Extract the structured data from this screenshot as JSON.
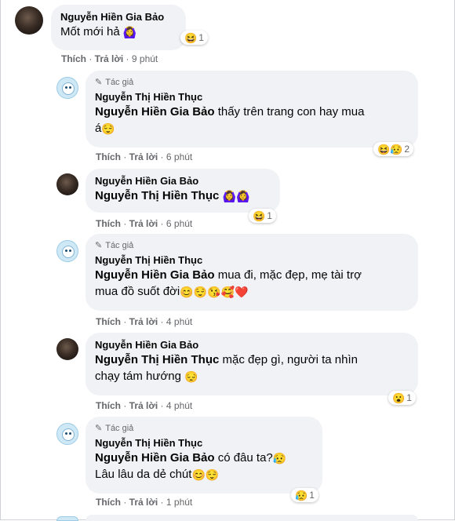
{
  "comments": [
    {
      "author": "Nguyễn Hiền Gia Bảo",
      "text": "Mốt mới hả",
      "emoji": "🙆‍♀️",
      "reaction": {
        "icon": "😆",
        "count": "1"
      },
      "actions": {
        "like": "Thích",
        "reply": "Trả lời",
        "time": "9 phút"
      }
    },
    {
      "author_tag": "Tác giả",
      "author": "Nguyễn Thị Hiền Thục",
      "mention": "Nguyễn Hiền Gia Bảo",
      "text_line1": " thấy trên trang con hay mua",
      "text_line2": "á",
      "emoji": "😌",
      "reaction": {
        "icon": "😆😥",
        "count": "2"
      },
      "actions": {
        "like": "Thích",
        "reply": "Trả lời",
        "time": "6 phút"
      }
    },
    {
      "author": "Nguyễn Hiền Gia Bảo",
      "mention": "Nguyễn Thị Hiền Thục",
      "emoji": "🙆‍♀️🙆‍♀️",
      "reaction": {
        "icon": "😆",
        "count": "1"
      },
      "actions": {
        "like": "Thích",
        "reply": "Trả lời",
        "time": "6 phút"
      }
    },
    {
      "author_tag": "Tác giả",
      "author": "Nguyễn Thị Hiền Thục",
      "mention": "Nguyễn Hiền Gia Bảo",
      "text_line1": " mua đi, mặc đẹp, mẹ tài trợ",
      "text_line2": "mua đồ suốt đời",
      "emoji": "😊😌😘🥰❤️",
      "actions": {
        "like": "Thích",
        "reply": "Trả lời",
        "time": "4 phút"
      }
    },
    {
      "author": "Nguyễn Hiền Gia Bảo",
      "mention": "Nguyễn Thị Hiền Thục",
      "text_line1": " mặc đẹp gì, người ta nhìn",
      "text_line2": "chạy tám hướng",
      "emoji": "😔",
      "reaction": {
        "icon": "😮",
        "count": "1"
      },
      "actions": {
        "like": "Thích",
        "reply": "Trả lời",
        "time": "4 phút"
      }
    },
    {
      "author_tag": "Tác giả",
      "author": "Nguyễn Thị Hiền Thục",
      "mention": "Nguyễn Hiền Gia Bảo",
      "text_line1": " có đâu ta?",
      "emoji1": "😥",
      "text_line2": "Lâu lâu da dẻ chút",
      "emoji2": "😊😌",
      "reaction": {
        "icon": "😥",
        "count": "1"
      },
      "actions": {
        "like": "Thích",
        "reply": "Trả lời",
        "time": "1 phút"
      }
    }
  ]
}
